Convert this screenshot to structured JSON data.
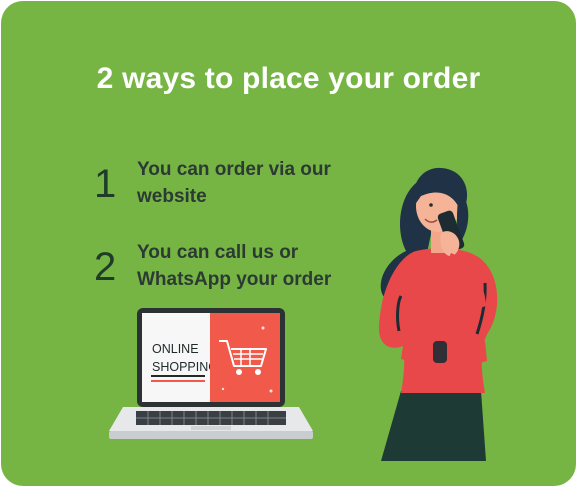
{
  "title": "2 ways to place your order",
  "steps": [
    {
      "number": "1",
      "text": "You can order via our website"
    },
    {
      "number": "2",
      "text": "You can call us or WhatsApp your order"
    }
  ],
  "laptop": {
    "screen_text_line1": "ONLINE",
    "screen_text_line2": "SHOPPING"
  },
  "icons": {
    "cart": "shopping-cart-icon",
    "laptop": "laptop-illustration",
    "person": "woman-on-phone-illustration"
  },
  "colors": {
    "background": "#76b444",
    "title": "#ffffff",
    "text": "#2b3b33",
    "accent_red": "#f15a4a",
    "shirt": "#e8484a",
    "pants": "#1d3a35"
  }
}
